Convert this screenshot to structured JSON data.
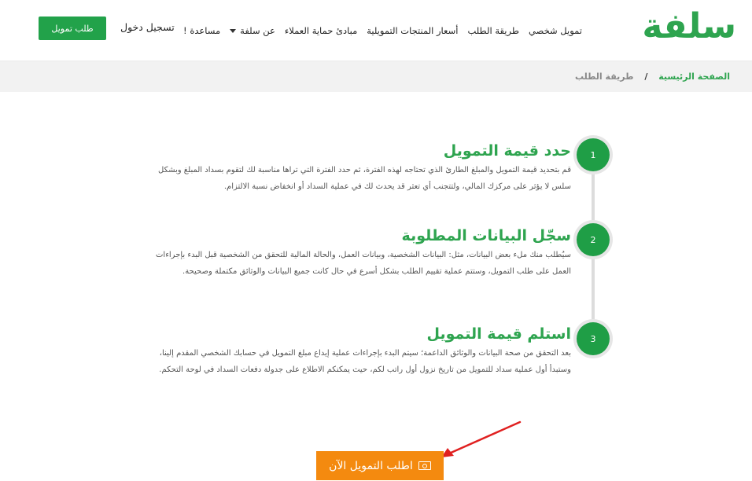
{
  "header": {
    "logo_text": "سلفة",
    "nav": [
      {
        "label": "تمويل شخصي"
      },
      {
        "label": "طريقة الطلب"
      },
      {
        "label": "أسعار المنتجات التمويلية"
      },
      {
        "label": "مبادئ حماية العملاء"
      },
      {
        "label": "عن سلفة"
      },
      {
        "label": "مساعدة !"
      }
    ],
    "login_label": "تسجيل دخول",
    "apply_button_label": "طلب تمويل"
  },
  "breadcrumb": {
    "home": "الصفحة الرئيسية",
    "separator": "/",
    "current": "طريقة الطلب"
  },
  "steps": [
    {
      "number": "1",
      "title": "حدد قيمة التمويل",
      "description": "قم بتحديد قيمة التمويل والمبلغ الطارئ الذي تحتاجه لهذه الفترة، ثم حدد الفترة التي تراها مناسبة لك لتقوم بسداد المبلغ وبشكل سلس لا يؤثر على مركزك المالي، ولتتجنب أي تعثر قد يحدث لك في عملية السداد أو انخفاض نسبة الالتزام."
    },
    {
      "number": "2",
      "title": "سجّل البيانات المطلوبة",
      "description": "سيُطلب منك ملء بعض البيانات، مثل: البيانات الشخصية، وبيانات العمل، والحالة المالية للتحقق من الشخصية قبل البدء بإجراءات العمل على طلب التمويل، وستتم عملية تقييم الطلب بشكل أسرع في حال كانت جميع البيانات والوثائق مكتملة وصحيحة."
    },
    {
      "number": "3",
      "title": "استلم قيمة التمويل",
      "description": "بعد التحقق من صحة البيانات والوثائق الداعمة؛ سيتم البدء بإجراءات عملية إيداع مبلغ التمويل في حسابك الشخصي المقدم إلينا، وستبدأ أول عملية سداد للتمويل من تاريخ نزول أول راتب لكم، حيث يمكنكم الاطلاع على جدولة دفعات السداد في لوحة التحكم."
    }
  ],
  "cta": {
    "label": "اطلب التمويل الآن",
    "icon": "cash-icon"
  },
  "colors": {
    "brand_green": "#2ea44f",
    "button_green": "#22a24a",
    "cta_orange": "#f48a0f",
    "arrow_red": "#e02020"
  }
}
